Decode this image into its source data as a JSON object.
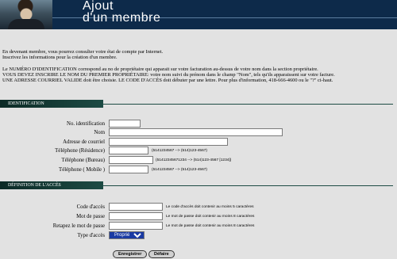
{
  "header": {
    "title_line1": "Ajout",
    "title_line2": "d'un membre"
  },
  "intro": {
    "line1": "En devenant membre, vous pourrez consulter votre état de compte par Internet.",
    "line2": "Inscrivez les informations pour la création d'un membre.",
    "line3": "Le NUMÉRO D'IDENTIFICATION correspond au no de propriétaire qui apparait sur votre facturation au-dessus de votre nom dans la section propriétaire.",
    "line4": "VOUS DEVEZ INSCRIRE LE NOM DU PREMIER PROPRIÉTAIRE: votre nom suivi du prénom dans le champ \"Nom\", tels qu'ils apparaissent sur votre facture.",
    "line5": "UNE ADRESSE COURRIEL VALIDE doit être choisie. LE CODE D'ACCÈS doit débuter par une lettre.  Pour plus d'information, 418-666-4600 ou le \"?\" ci-haut."
  },
  "identification": {
    "section_title": "IDENTIFICATION",
    "fields": {
      "id_label": "No. identification",
      "id_value": "",
      "name_label": "Nom",
      "name_value": "",
      "email_label": "Adresse de courriel",
      "email_value": "",
      "phone_home_label": "Téléphone (Résidence)",
      "phone_home_value": "",
      "phone_home_hint": "(5141234567 --> (514)123-4567)",
      "phone_work_label": "Téléphone (Bureau)",
      "phone_work_value": "",
      "phone_work_hint": "(51412345671234 --> (514)123-4567 [1234])",
      "phone_mobile_label": "Téléphone ( Mobile )",
      "phone_mobile_value": "",
      "phone_mobile_hint": "(5141234567 --> (514)123-4567)"
    }
  },
  "access": {
    "section_title": "DÉFINITION DE L'ACCÈS",
    "fields": {
      "code_label": "Code d'accès",
      "code_value": "",
      "code_hint": "Le code d'accès doit contenir au moins 5 caractères",
      "password_label": "Mot de passe",
      "password_value": "",
      "password_hint": "Le mot de passe doit contenir au moins 8 caractères",
      "password_confirm_label": "Retapez le mot de passe",
      "password_confirm_value": "",
      "password_confirm_hint": "Le mot de passe doit contenir au moins 8 caractères",
      "type_label": "Type d'accès",
      "type_selected": "Propriétaire"
    }
  },
  "buttons": {
    "save": "Enregistrer",
    "undo": "Défaire"
  },
  "colors": {
    "banner": "#0d2a4a",
    "section_bar": "#1d4b44",
    "page_bg": "#e2e2e2",
    "select_highlight": "#1a3aa3"
  }
}
